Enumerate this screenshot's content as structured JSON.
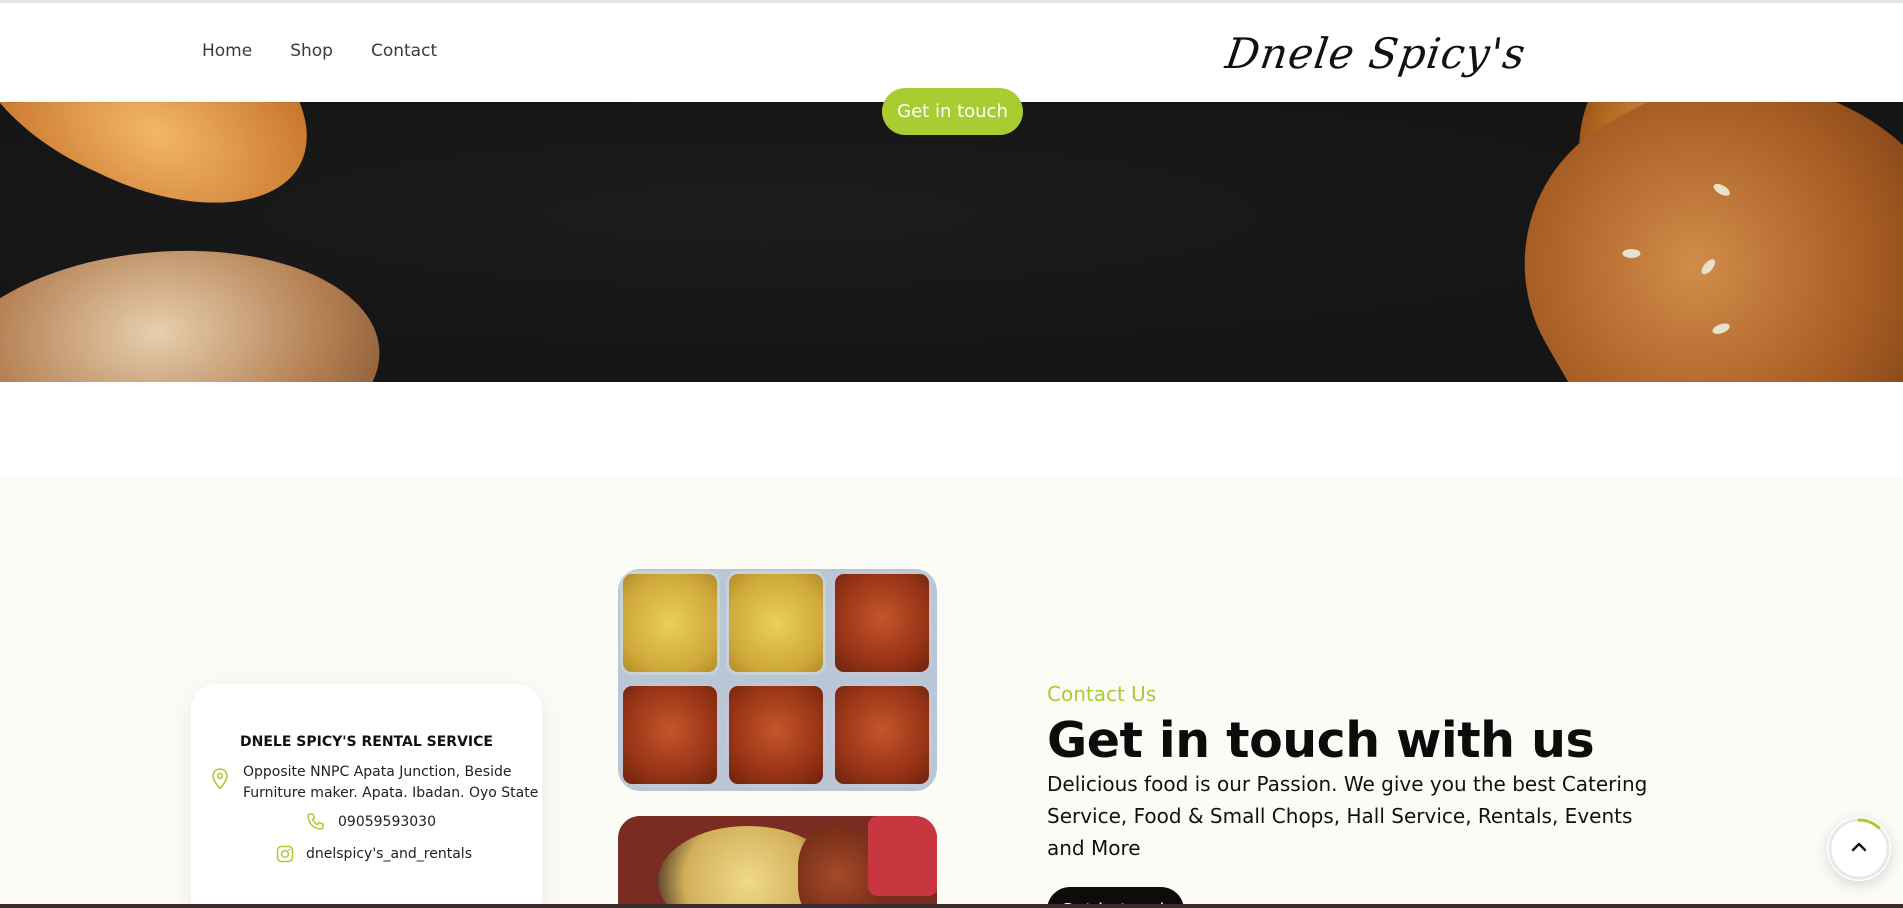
{
  "nav": {
    "links": [
      "Home",
      "Shop",
      "Contact"
    ],
    "logo_text": "Dnele Spicy's"
  },
  "hero": {
    "cta_label": "Get in touch"
  },
  "contact_card": {
    "title": "DNELE SPICY'S RENTAL SERVICE",
    "address_line1": "Opposite NNPC Apata Junction, Beside",
    "address_line2": "Furniture maker. Apata. Ibadan. Oyo State",
    "phone": "09059593030",
    "instagram": "dnelspicy's_and_rentals",
    "icons": [
      "location-pin-icon",
      "phone-icon",
      "instagram-icon"
    ]
  },
  "contact": {
    "eyebrow": "Contact Us",
    "heading": "Get in touch with us",
    "description": "Delicious food is our Passion. We give you the best Catering Service, Food & Small Chops, Hall Service, Rentals, Events and More",
    "cta_label": "Get in touch"
  },
  "scroll_top": {
    "icon": "chevron-up-icon",
    "progress": 0.12
  },
  "colors": {
    "accent": "#a9cc33",
    "dark": "#0c0c0c",
    "section_bg": "#fcfcf7"
  }
}
